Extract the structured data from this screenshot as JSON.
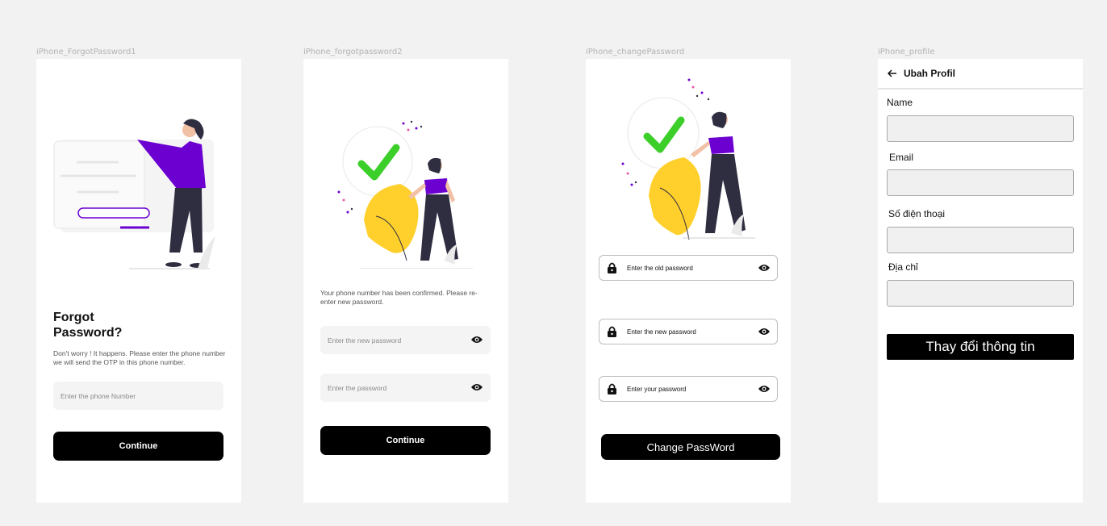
{
  "frames": {
    "f1": {
      "label": "iPhone_ForgotPassword1",
      "title": "Forgot\nPassword?",
      "description": "Don't worry ! It happens. Please enter the phone number we will send the OTP in this phone number.",
      "phone_placeholder": "Enter the phone Number",
      "continue_label": "Continue"
    },
    "f2": {
      "label": "iPhone_forgotpassword2",
      "message": "Your phone number has been confirmed. Please re-enter new password.",
      "new_password_placeholder": "Enter the new password",
      "password_placeholder": "Enter the password",
      "continue_label": "Continue"
    },
    "f3": {
      "label": "iPhone_changePassword",
      "old_password_placeholder": "Enter the old password",
      "new_password_placeholder": "Enter the new password",
      "your_password_placeholder": "Enter your password",
      "change_label": "Change PassWord"
    },
    "f4": {
      "label": "iPhone_profile",
      "header_title": "Ubah Profil",
      "name_label": "Name",
      "email_label": "Email",
      "phone_label": "Số điện thoại",
      "address_label": "Địa chỉ",
      "submit_label": "Thay đổi thông tin"
    }
  },
  "colors": {
    "accent_purple": "#6c00d1",
    "check_green": "#3ccf2a",
    "leaf_yellow": "#ffd02c",
    "button_black": "#000000",
    "input_gray": "#f0f0f0"
  }
}
